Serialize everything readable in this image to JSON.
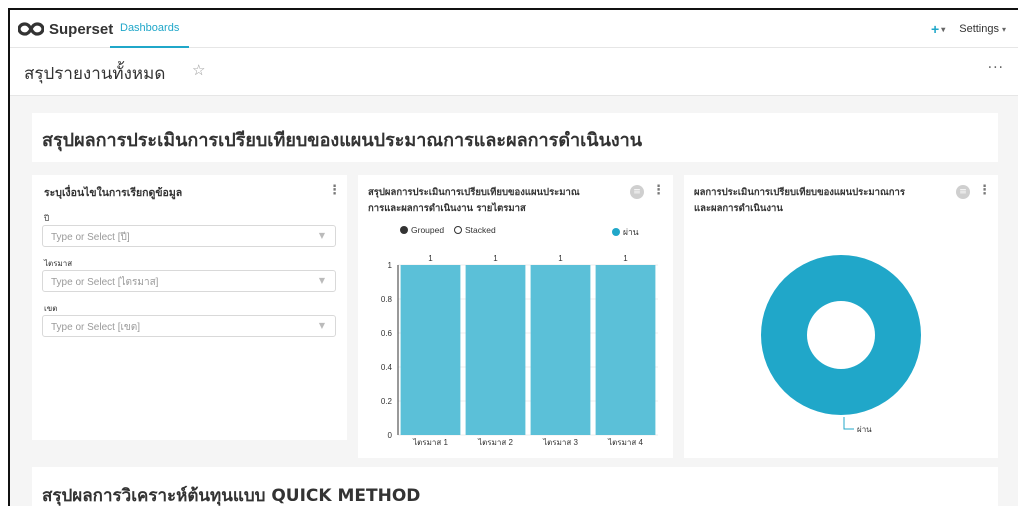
{
  "app": {
    "brand": "Superset",
    "nav_tab": "Dashboards",
    "plus_label": "+",
    "settings_label": "Settings"
  },
  "dashboard": {
    "title": "สรุปรายงานทั้งหมด",
    "more_label": "···"
  },
  "header_text": "สรุปผลการประเมินการเปรียบเทียบของแผนประมาณการและผลการดำเนินงาน",
  "filter_box": {
    "title": "ระบุเงื่อนไขในการเรียกดูข้อมูล",
    "filters": [
      {
        "label": "ปี",
        "placeholder": "Type or Select [ปี]"
      },
      {
        "label": "ไตรมาส",
        "placeholder": "Type or Select [ไตรมาส]"
      },
      {
        "label": "เขต",
        "placeholder": "Type or Select [เขต]"
      }
    ]
  },
  "bar_card": {
    "title_line1": "สรุปผลการประเมินการเปรียบเทียบของแผนประมาณ",
    "title_line2": "การและผลการดำเนินงาน รายไตรมาส",
    "controls": [
      "Grouped",
      "Stacked"
    ]
  },
  "pie_card": {
    "title_line1": "ผลการประเมินการเปรียบเทียบของแผนประมาณการ",
    "title_line2": "และผลการดำเนินงาน"
  },
  "bottom_text": "สรุปผลการวิเคราะห์ต้นทุนแบบ QUICK METHOD",
  "chart_data": [
    {
      "type": "bar",
      "categories": [
        "ไตรมาส 1",
        "ไตรมาส 2",
        "ไตรมาส 3",
        "ไตรมาส 4"
      ],
      "series": [
        {
          "name": "ผ่าน",
          "values": [
            1,
            1,
            1,
            1
          ]
        }
      ],
      "ylim": [
        0,
        1
      ],
      "yticks": [
        "0",
        "0.2",
        "0.4",
        "0.6",
        "0.8",
        "1"
      ],
      "data_labels": [
        "1",
        "1",
        "1",
        "1"
      ],
      "legend": "top-right",
      "grid": true,
      "color": "#5bc0d8"
    },
    {
      "type": "pie",
      "donut": true,
      "labels": [
        "ผ่าน"
      ],
      "values": [
        1
      ],
      "color": "#20a7c9"
    }
  ]
}
